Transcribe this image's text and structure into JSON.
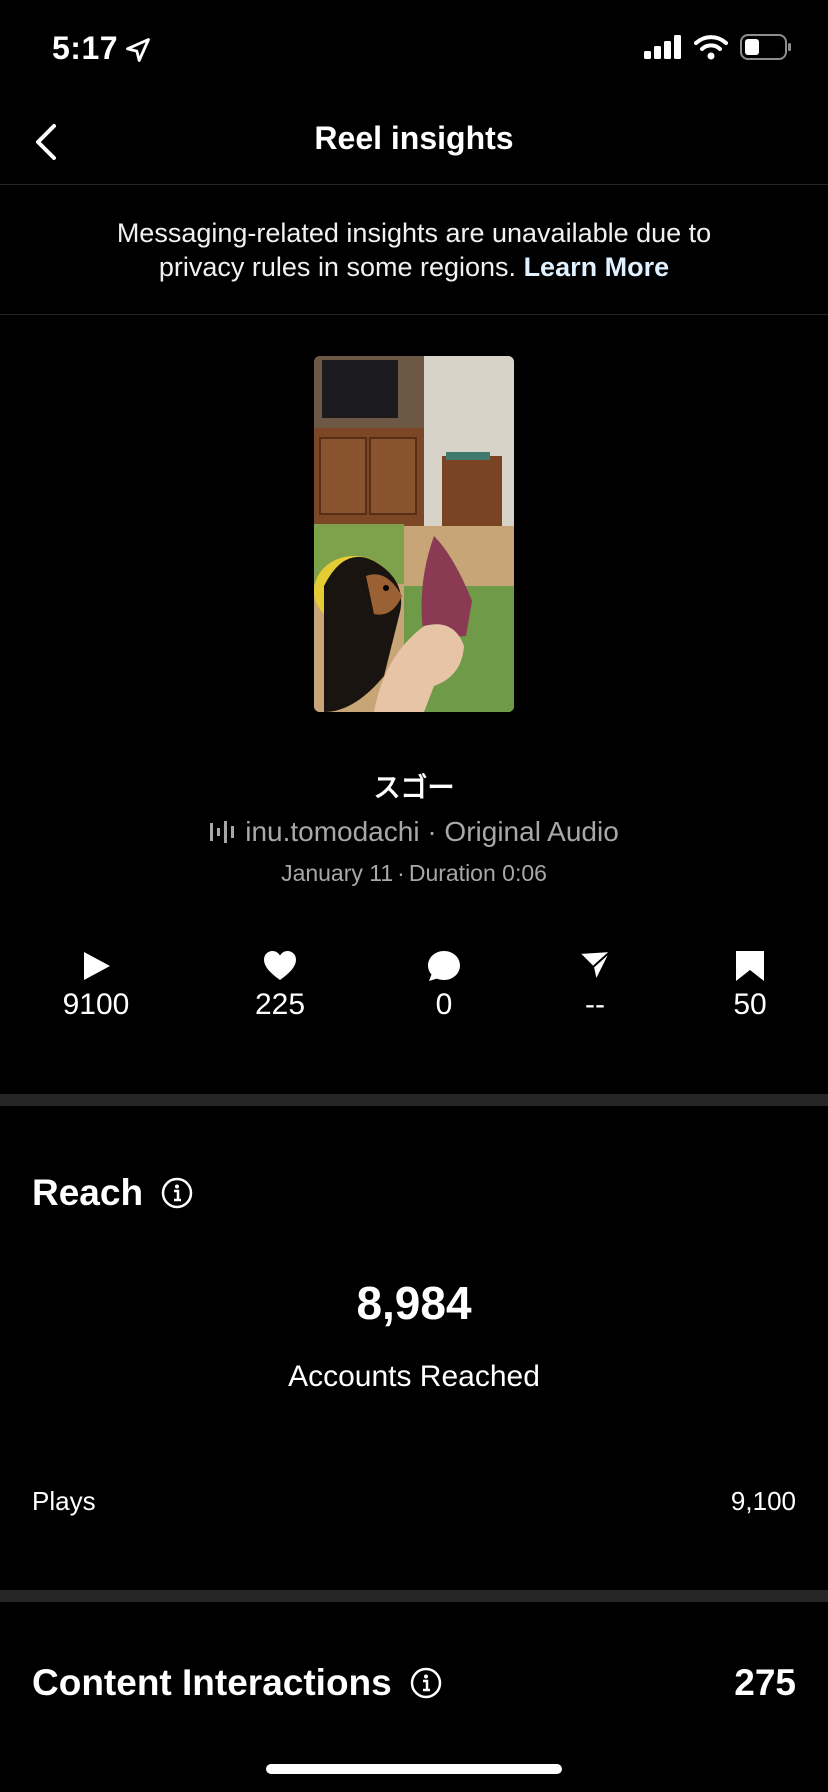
{
  "status_bar": {
    "time": "5:17"
  },
  "nav": {
    "title": "Reel insights"
  },
  "notice": {
    "text": "Messaging-related insights are unavailable due to privacy rules in some regions.",
    "link": "Learn More"
  },
  "reel": {
    "title": "スゴー",
    "audio": "inu.tomodachi · Original Audio",
    "date": "January 11",
    "duration": "Duration 0:06"
  },
  "metrics": [
    {
      "icon": "play-icon",
      "value": "9100"
    },
    {
      "icon": "heart-icon",
      "value": "225"
    },
    {
      "icon": "comment-icon",
      "value": "0"
    },
    {
      "icon": "share-icon",
      "value": "--"
    },
    {
      "icon": "bookmark-icon",
      "value": "50"
    }
  ],
  "reach": {
    "title": "Reach",
    "value": "8,984",
    "label": "Accounts Reached",
    "plays_label": "Plays",
    "plays_value": "9,100"
  },
  "content_interactions": {
    "title": "Content Interactions",
    "value": "275"
  },
  "colors": {
    "background": "#000000",
    "secondary_text": "#a8a8a8",
    "divider": "#262626"
  }
}
